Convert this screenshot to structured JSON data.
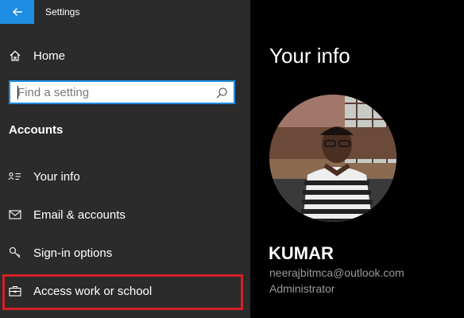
{
  "window": {
    "title": "Settings"
  },
  "sidebar": {
    "home_label": "Home",
    "search": {
      "placeholder": "Find a setting"
    },
    "section_heading": "Accounts",
    "items": [
      {
        "label": "Your info",
        "icon": "person-card-icon"
      },
      {
        "label": "Email & accounts",
        "icon": "mail-icon"
      },
      {
        "label": "Sign-in options",
        "icon": "key-icon"
      },
      {
        "label": "Access work or school",
        "icon": "briefcase-icon"
      }
    ],
    "highlighted_item": "Access work or school"
  },
  "main": {
    "title": "Your info",
    "user": {
      "name": "KUMAR",
      "email": "neerajbitmca@outlook.com",
      "role": "Administrator"
    }
  },
  "colors": {
    "accent": "#1e8de2",
    "sidebar_bg": "#2b2b2b",
    "content_bg": "#000000",
    "highlight_border": "#d41f26",
    "secondary_text": "#9a9a9a"
  }
}
